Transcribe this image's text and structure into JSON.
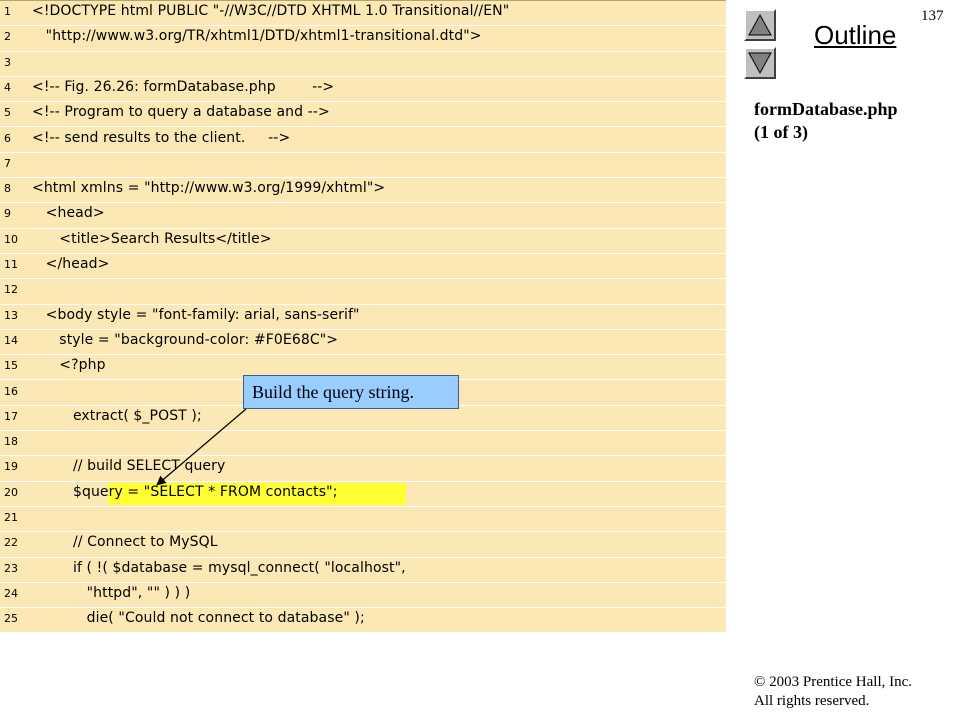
{
  "slide": {
    "number": "137",
    "outline_title": "Outline",
    "file_label_line1": "formDatabase.php",
    "file_label_line2": "(1 of 3)",
    "copyright_line1": "© 2003 Prentice Hall, Inc.",
    "copyright_line2": "All rights reserved.",
    "nav_up_icon": "triangle-up-icon",
    "nav_down_icon": "triangle-down-icon"
  },
  "callout": {
    "text": "Build the query string."
  },
  "highlight_color": "#ffff33",
  "code_background": "#fbe8b4",
  "code": {
    "lines": [
      {
        "n": "1",
        "text": "<!DOCTYPE html PUBLIC \"-//W3C//DTD XHTML 1.0 Transitional//EN\""
      },
      {
        "n": "2",
        "text": "   \"http://www.w3.org/TR/xhtml1/DTD/xhtml1-transitional.dtd\">"
      },
      {
        "n": "3",
        "text": ""
      },
      {
        "n": "4",
        "text": "<!-- Fig. 26.26: formDatabase.php        -->"
      },
      {
        "n": "5",
        "text": "<!-- Program to query a database and -->"
      },
      {
        "n": "6",
        "text": "<!-- send results to the client.     -->"
      },
      {
        "n": "7",
        "text": ""
      },
      {
        "n": "8",
        "text": "<html xmlns = \"http://www.w3.org/1999/xhtml\">"
      },
      {
        "n": "9",
        "text": "   <head>"
      },
      {
        "n": "10",
        "text": "      <title>Search Results</title>"
      },
      {
        "n": "11",
        "text": "   </head>"
      },
      {
        "n": "12",
        "text": ""
      },
      {
        "n": "13",
        "text": "   <body style = \"font-family: arial, sans-serif\""
      },
      {
        "n": "14",
        "text": "      style = \"background-color: #F0E68C\">"
      },
      {
        "n": "15",
        "text": "      <?php"
      },
      {
        "n": "16",
        "text": ""
      },
      {
        "n": "17",
        "text": "         extract( $_POST );"
      },
      {
        "n": "18",
        "text": ""
      },
      {
        "n": "19",
        "text": "         // build SELECT query"
      },
      {
        "n": "20",
        "text": "         $query = \"SELECT * FROM contacts\";"
      },
      {
        "n": "21",
        "text": ""
      },
      {
        "n": "22",
        "text": "         // Connect to MySQL"
      },
      {
        "n": "23",
        "text": "         if ( !( $database = mysql_connect( \"localhost\","
      },
      {
        "n": "24",
        "text": "            \"httpd\", \"\" ) ) )"
      },
      {
        "n": "25",
        "text": "            die( \"Could not connect to database\" );"
      }
    ]
  }
}
